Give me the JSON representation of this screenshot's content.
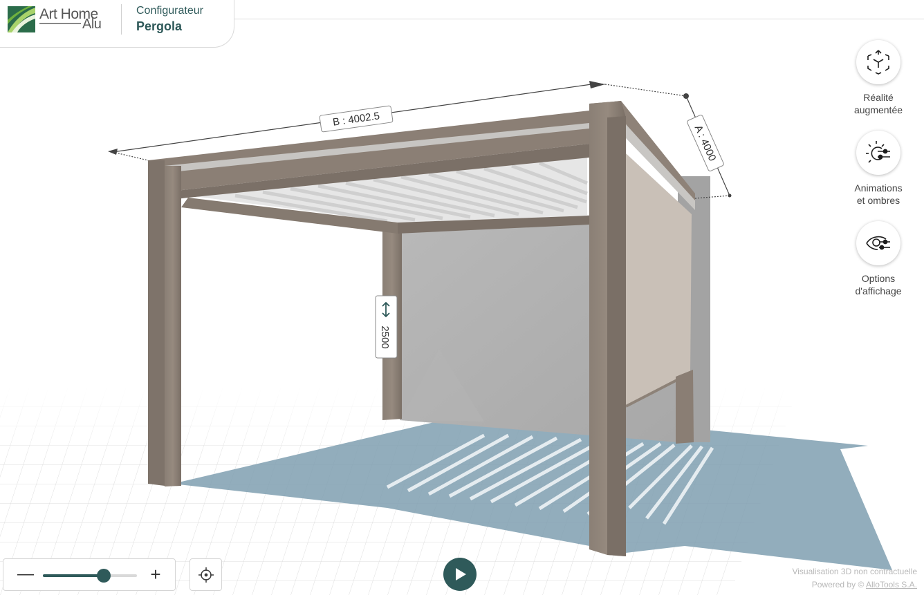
{
  "header": {
    "logo_line1": "Art Home",
    "logo_line2": "Alu",
    "subtitle": "Configurateur",
    "title": "Pergola"
  },
  "side_actions": [
    {
      "label": "Réalité\naugmentée",
      "icon": "ar-cube-icon"
    },
    {
      "label": "Animations\net ombres",
      "icon": "sun-shadow-icon"
    },
    {
      "label": "Options\nd'affichage",
      "icon": "eye-settings-icon"
    }
  ],
  "dimensions": {
    "width_label": "B : 4002.5",
    "depth_label": "A : 4000",
    "height_value": "2500"
  },
  "zoom": {
    "minus": "—",
    "plus": "+",
    "level": 0.65
  },
  "footer": {
    "disclaimer": "Visualisation 3D non contractuelle",
    "powered_prefix": "Powered by © ",
    "powered_link": "AlloTools S.A."
  },
  "colors": {
    "accent": "#2f5a5a",
    "frame": "#8a7e74",
    "shadow": "#7f9fb0",
    "screen": "#c9c0b7"
  }
}
